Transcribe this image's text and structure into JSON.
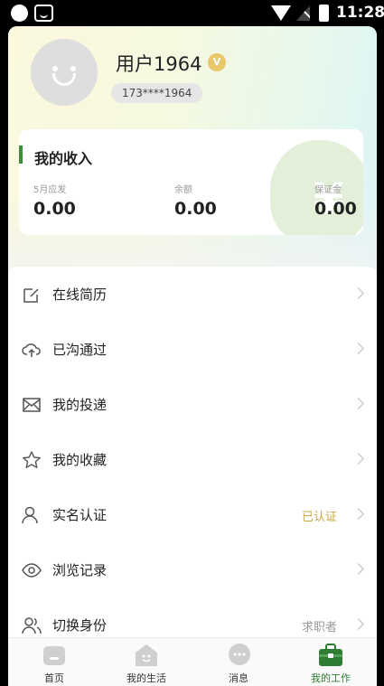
{
  "status_bar": {
    "time": "11:28"
  },
  "profile": {
    "username": "用户1964",
    "vip_badge": "V",
    "phone": "173****1964"
  },
  "income": {
    "title": "我的收入",
    "stats": [
      {
        "label": "5月应发",
        "value": "0.00"
      },
      {
        "label": "余额",
        "value": "0.00"
      },
      {
        "label": "保证金",
        "value": "0.00"
      }
    ],
    "bag_symbol": "¥"
  },
  "menu": {
    "items": [
      {
        "label": "在线简历",
        "icon": "edit-icon"
      },
      {
        "label": "已沟通过",
        "icon": "cloud-upload-icon"
      },
      {
        "label": "我的投递",
        "icon": "mail-icon"
      },
      {
        "label": "我的收藏",
        "icon": "star-icon"
      },
      {
        "label": "实名认证",
        "icon": "user-icon",
        "status": "已认证",
        "status_color": "#c9a94a"
      },
      {
        "label": "浏览记录",
        "icon": "eye-icon"
      },
      {
        "label": "切换身份",
        "icon": "users-icon",
        "status": "求职者",
        "status_color": "#999999"
      }
    ]
  },
  "tabbar": {
    "tabs": [
      {
        "label": "首页",
        "icon": "home-icon"
      },
      {
        "label": "我的生活",
        "icon": "life-icon"
      },
      {
        "label": "消息",
        "icon": "message-icon"
      },
      {
        "label": "我的工作",
        "icon": "briefcase-icon",
        "active": true
      }
    ],
    "active_color": "#2e7d32"
  }
}
